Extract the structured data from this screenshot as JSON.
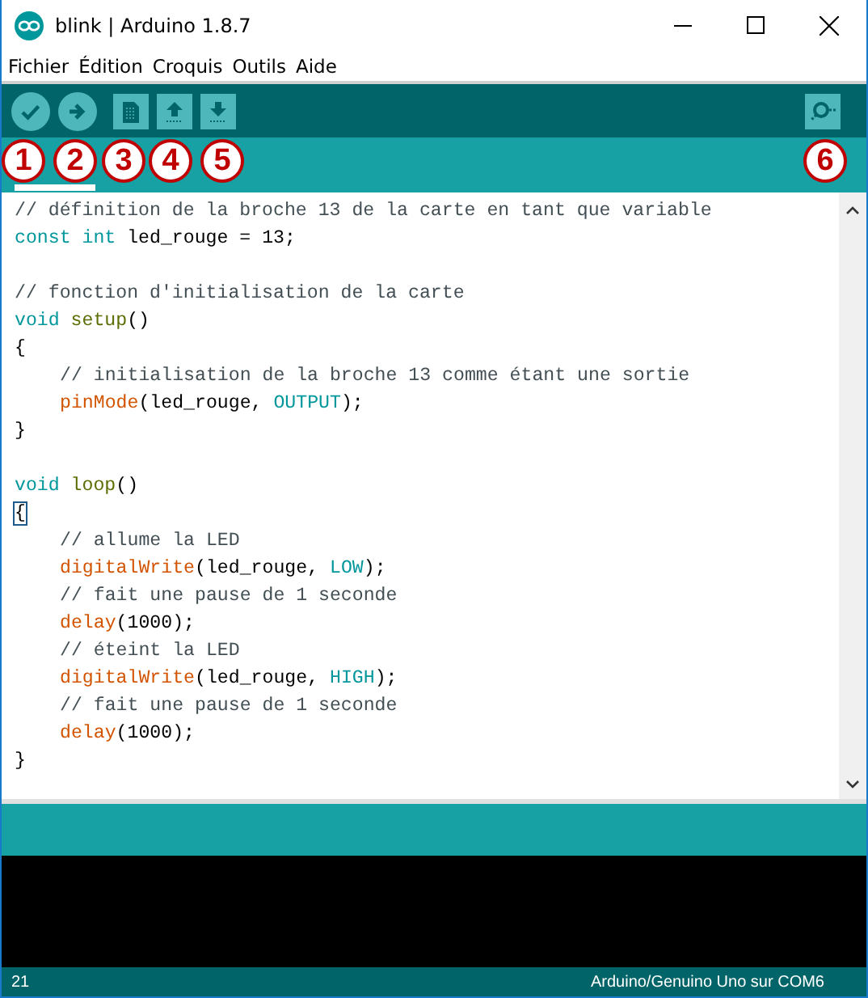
{
  "window": {
    "title": "blink | Arduino 1.8.7"
  },
  "menu": [
    "Fichier",
    "Édition",
    "Croquis",
    "Outils",
    "Aide"
  ],
  "callouts": [
    "1",
    "2",
    "3",
    "4",
    "5",
    "6"
  ],
  "code_blocks": [
    [
      {
        "indented": false,
        "tokens": [
          {
            "kind": "comment",
            "text": "// définition de la broche 13 de la carte en tant que variable"
          }
        ]
      },
      {
        "indented": false,
        "tokens": [
          {
            "kind": "keyword",
            "text": "const int"
          },
          {
            "kind": "plain",
            "text": " led_rouge = 13;"
          }
        ]
      }
    ],
    [
      {
        "indented": false,
        "tokens": [
          {
            "kind": "comment",
            "text": "// fonction d'initialisation de la carte"
          }
        ]
      },
      {
        "indented": false,
        "tokens": [
          {
            "kind": "keyword",
            "text": "void"
          },
          {
            "kind": "method",
            "text": " setup"
          },
          {
            "kind": "plain",
            "text": "()"
          }
        ]
      },
      {
        "indented": false,
        "tokens": [
          {
            "kind": "plain",
            "text": "{"
          }
        ]
      },
      {
        "indented": true,
        "tokens": [
          {
            "kind": "comment",
            "text": "// initialisation de la broche 13 comme étant une sortie"
          }
        ]
      },
      {
        "indented": true,
        "tokens": [
          {
            "kind": "function",
            "text": "pinMode"
          },
          {
            "kind": "plain",
            "text": "(led_rouge, "
          },
          {
            "kind": "keyword",
            "text": "OUTPUT"
          },
          {
            "kind": "plain",
            "text": ");"
          }
        ]
      },
      {
        "indented": false,
        "tokens": [
          {
            "kind": "plain",
            "text": "}"
          }
        ]
      }
    ],
    [
      {
        "indented": false,
        "tokens": [
          {
            "kind": "keyword",
            "text": "void"
          },
          {
            "kind": "method",
            "text": " loop"
          },
          {
            "kind": "plain",
            "text": "()"
          }
        ]
      },
      {
        "indented": false,
        "tokens": [
          {
            "kind": "bracket",
            "text": "{"
          }
        ]
      },
      {
        "indented": true,
        "tokens": [
          {
            "kind": "comment",
            "text": "// allume la LED"
          }
        ]
      },
      {
        "indented": true,
        "tokens": [
          {
            "kind": "function",
            "text": "digitalWrite"
          },
          {
            "kind": "plain",
            "text": "(led_rouge, "
          },
          {
            "kind": "keyword",
            "text": "LOW"
          },
          {
            "kind": "plain",
            "text": ");"
          }
        ]
      },
      {
        "indented": true,
        "tokens": [
          {
            "kind": "comment",
            "text": "// fait une pause de 1 seconde"
          }
        ]
      },
      {
        "indented": true,
        "tokens": [
          {
            "kind": "function",
            "text": "delay"
          },
          {
            "kind": "plain",
            "text": "(1000);"
          }
        ]
      },
      {
        "indented": true,
        "tokens": [
          {
            "kind": "comment",
            "text": "// éteint la LED"
          }
        ]
      },
      {
        "indented": true,
        "tokens": [
          {
            "kind": "function",
            "text": "digitalWrite"
          },
          {
            "kind": "plain",
            "text": "(led_rouge, "
          },
          {
            "kind": "keyword",
            "text": "HIGH"
          },
          {
            "kind": "plain",
            "text": ");"
          }
        ]
      },
      {
        "indented": true,
        "tokens": [
          {
            "kind": "comment",
            "text": "// fait une pause de 1 seconde"
          }
        ]
      },
      {
        "indented": true,
        "tokens": [
          {
            "kind": "function",
            "text": "delay"
          },
          {
            "kind": "plain",
            "text": "(1000);"
          }
        ]
      },
      {
        "indented": false,
        "tokens": [
          {
            "kind": "plain",
            "text": "}"
          }
        ]
      }
    ]
  ],
  "status_bar": {
    "line": "21",
    "board": "Arduino/Genuino Uno sur COM6"
  }
}
